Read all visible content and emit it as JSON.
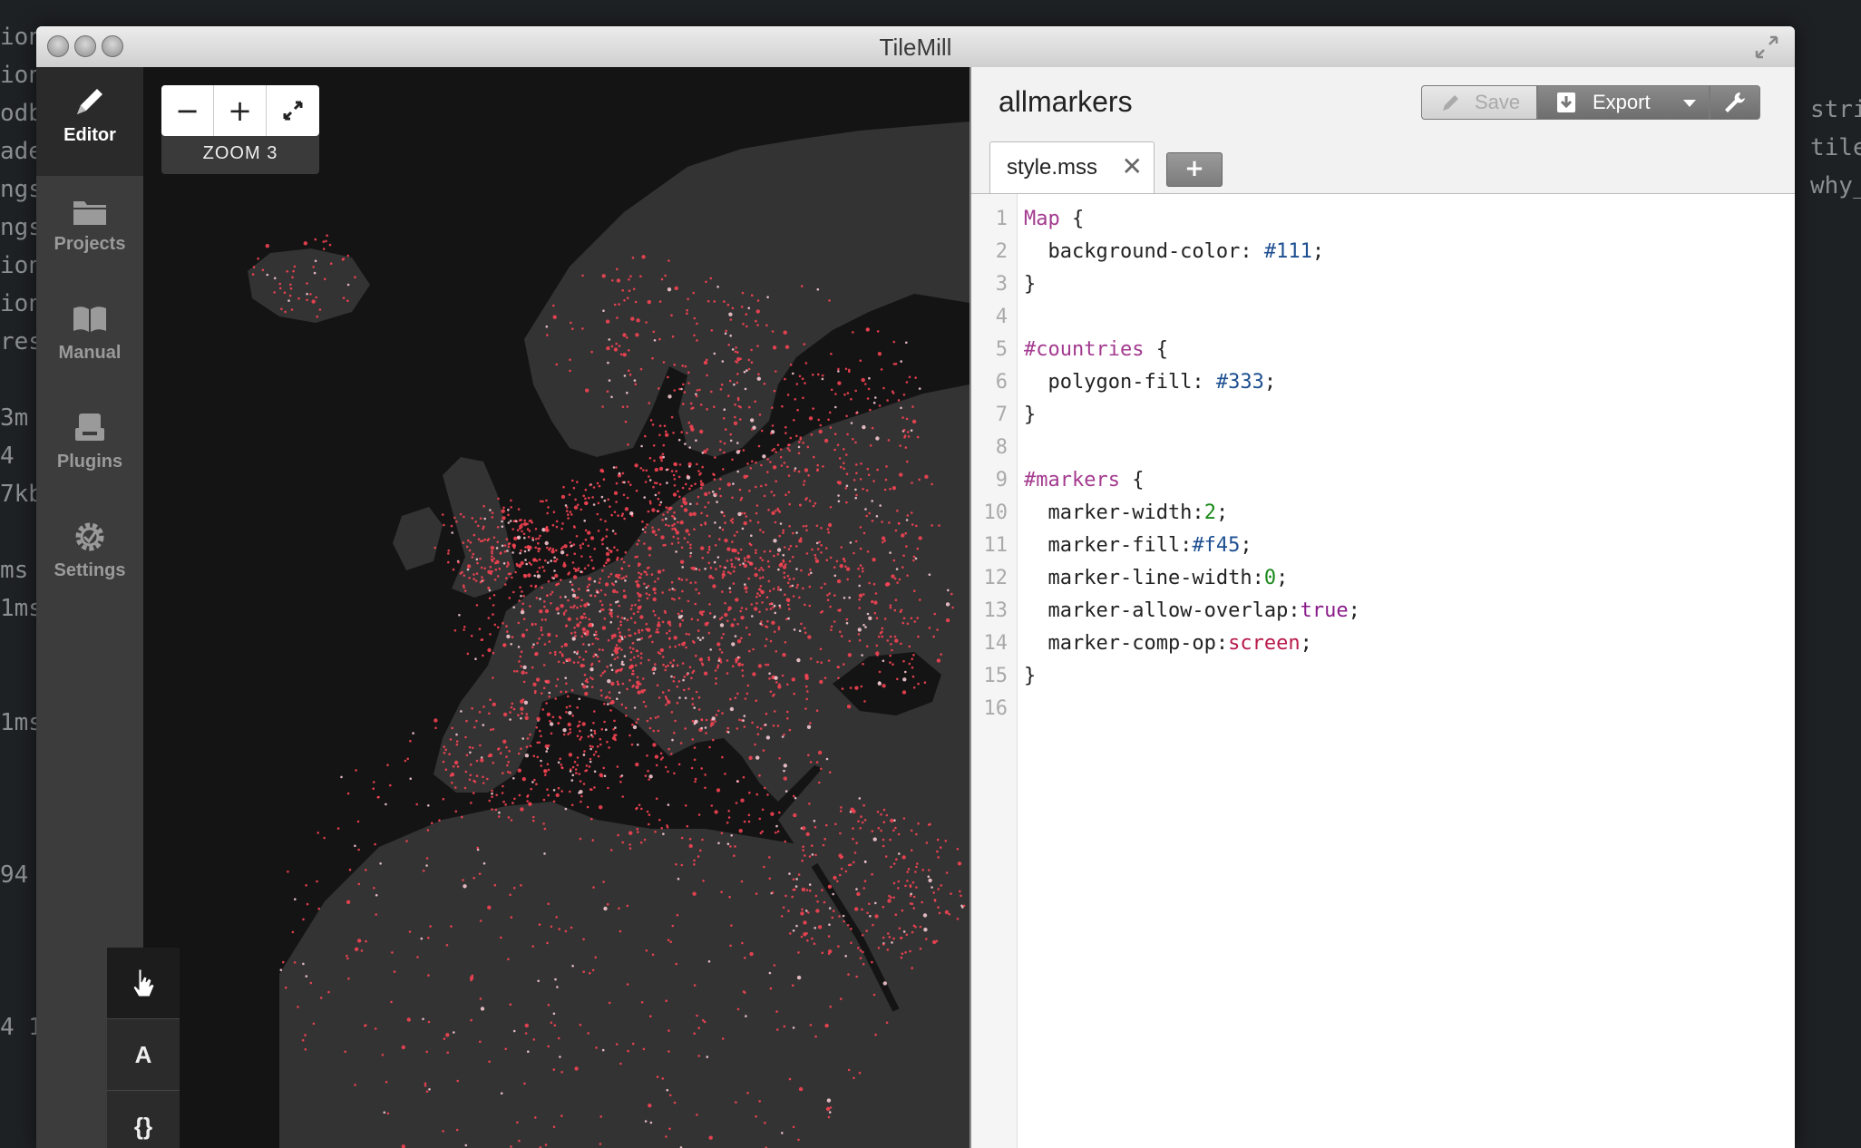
{
  "background_terminal": {
    "left_lines": [
      "ion",
      "ion",
      "odb",
      "ade",
      "ngs",
      "ngs",
      "ion",
      "ion",
      "res",
      "",
      "3m",
      "4",
      "7kb",
      "",
      "ms",
      "1ms",
      "",
      "",
      "1ms",
      "",
      "",
      "",
      "94",
      "",
      "",
      "",
      "4 1"
    ],
    "right_lines": [
      "stri",
      "tile",
      "why_"
    ]
  },
  "window": {
    "title": "TileMill"
  },
  "sidebar": {
    "items": [
      {
        "label": "Editor",
        "icon": "pencil-icon",
        "active": true
      },
      {
        "label": "Projects",
        "icon": "folder-icon",
        "active": false
      },
      {
        "label": "Manual",
        "icon": "book-icon",
        "active": false
      },
      {
        "label": "Plugins",
        "icon": "plugin-icon",
        "active": false
      },
      {
        "label": "Settings",
        "icon": "gear-icon",
        "active": false
      }
    ]
  },
  "map": {
    "zoom_label": "ZOOM 3",
    "zoom_out": "−",
    "zoom_in": "+",
    "fullscreen": "⤢",
    "background_color": "#141414",
    "land_color": "#333333",
    "marker_color": "#ff4455",
    "tools": [
      {
        "name": "pan-tool",
        "glyph": "☚"
      },
      {
        "name": "label-tool",
        "glyph": "A"
      },
      {
        "name": "template-tool",
        "glyph": "{}"
      }
    ]
  },
  "editor": {
    "project_title": "allmarkers",
    "toolbar": {
      "save_label": "Save",
      "export_label": "Export"
    },
    "tab": {
      "name": "style.mss",
      "close": "✕",
      "add": "+"
    },
    "code_lines": [
      [
        [
          "Map",
          "sel"
        ],
        [
          " {",
          ""
        ]
      ],
      [
        [
          "  background-color: ",
          ""
        ],
        [
          "#111",
          "val"
        ],
        [
          ";",
          ""
        ]
      ],
      [
        [
          "}",
          ""
        ]
      ],
      [],
      [
        [
          "#countries",
          "sel"
        ],
        [
          " {",
          ""
        ]
      ],
      [
        [
          "  polygon-fill: ",
          ""
        ],
        [
          "#333",
          "val"
        ],
        [
          ";",
          ""
        ]
      ],
      [
        [
          "}",
          ""
        ]
      ],
      [],
      [
        [
          "#markers",
          "sel"
        ],
        [
          " {",
          ""
        ]
      ],
      [
        [
          "  marker-width:",
          ""
        ],
        [
          "2",
          "num"
        ],
        [
          ";",
          ""
        ]
      ],
      [
        [
          "  marker-fill:",
          ""
        ],
        [
          "#f45",
          "val"
        ],
        [
          ";",
          ""
        ]
      ],
      [
        [
          "  marker-line-width:",
          ""
        ],
        [
          "0",
          "num"
        ],
        [
          ";",
          ""
        ]
      ],
      [
        [
          "  marker-allow-overlap:",
          ""
        ],
        [
          "true",
          "kw"
        ],
        [
          ";",
          ""
        ]
      ],
      [
        [
          "  marker-comp-op:",
          ""
        ],
        [
          "screen",
          "str"
        ],
        [
          ";",
          ""
        ]
      ],
      [
        [
          "}",
          ""
        ]
      ],
      []
    ]
  }
}
